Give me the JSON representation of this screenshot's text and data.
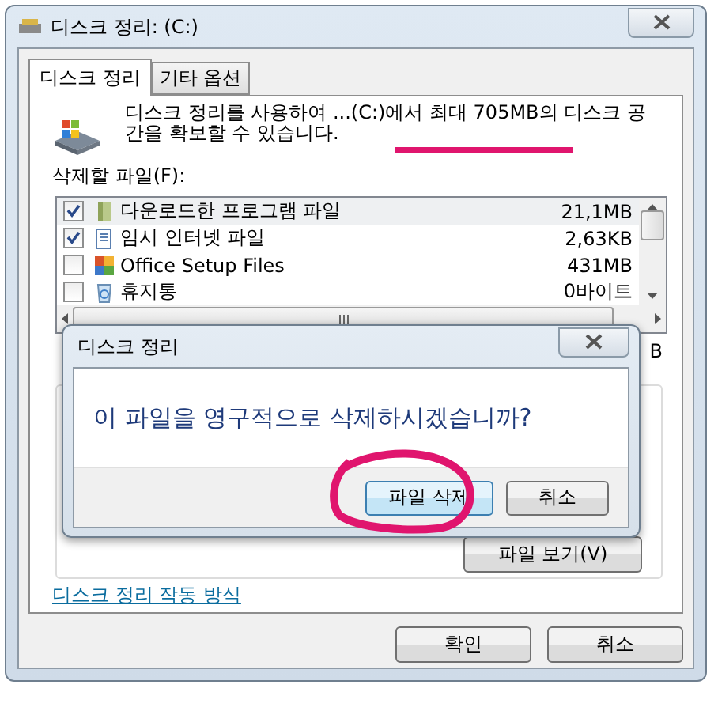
{
  "window": {
    "title": "디스크 정리: (C:)"
  },
  "tabs": [
    {
      "label": "디스크 정리",
      "selected": true
    },
    {
      "label": "기타 옵션",
      "selected": false
    }
  ],
  "description": "디스크 정리를 사용하여 ...(C:)에서 최대 705MB의 디스크 공간을 확보할 수 있습니다.",
  "files_label": "삭제할 파일(F):",
  "files": [
    {
      "kind": "folder",
      "name": "다운로드한 프로그램 파일",
      "size": "21,1MB",
      "checked": true,
      "selected": true
    },
    {
      "kind": "document",
      "name": "임시 인터넷 파일",
      "size": "2,63KB",
      "checked": true,
      "selected": false
    },
    {
      "kind": "office",
      "name": "Office Setup Files",
      "size": "431MB",
      "checked": false,
      "selected": false
    },
    {
      "kind": "recycle",
      "name": "휴지통",
      "size": "0바이트",
      "checked": false,
      "selected": false
    }
  ],
  "total_gain": {
    "value": "B"
  },
  "view_files_button": "파일 보기(V)",
  "help_link": "디스크 정리 작동 방식",
  "buttons": [
    "확인",
    "취소"
  ],
  "dialog": {
    "title": "디스크 정리",
    "message": "이 파일을 영구적으로 삭제하시겠습니까?",
    "buttons": [
      {
        "label": "파일 삭제",
        "default": true
      },
      {
        "label": "취소",
        "default": false
      }
    ]
  }
}
